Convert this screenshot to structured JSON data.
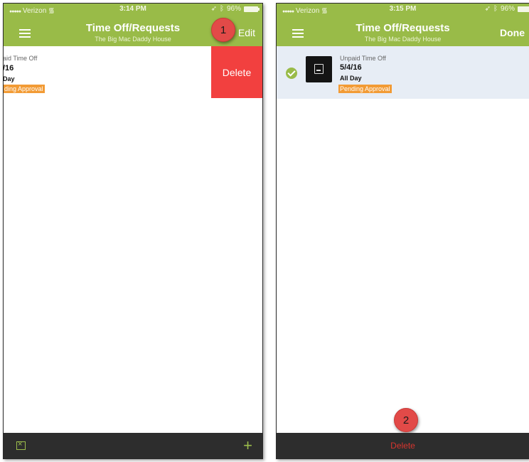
{
  "left": {
    "status": {
      "carrier": "Verizon",
      "time": "3:14 PM",
      "battery": "96%"
    },
    "nav": {
      "title": "Time Off/Requests",
      "subtitle": "The Big Mac Daddy House",
      "action": "Edit"
    },
    "callout": "1",
    "request": {
      "type": "aid Time Off",
      "date": "/16",
      "duration": "Day",
      "status": "ding Approval"
    },
    "swipe_action": "Delete"
  },
  "right": {
    "status": {
      "carrier": "Verizon",
      "time": "3:15 PM",
      "battery": "96%"
    },
    "nav": {
      "title": "Time Off/Requests",
      "subtitle": "The Big Mac Daddy House",
      "action": "Done"
    },
    "request": {
      "type": "Unpaid Time Off",
      "date": "5/4/16",
      "duration": "All Day",
      "status": "Pending Approval"
    },
    "callout": "2",
    "bottom_action": "Delete"
  },
  "colors": {
    "accent": "#99bb48",
    "status_orange": "#f29b35",
    "delete_red": "#f2403f",
    "bar_dark": "#2d2d2d"
  }
}
